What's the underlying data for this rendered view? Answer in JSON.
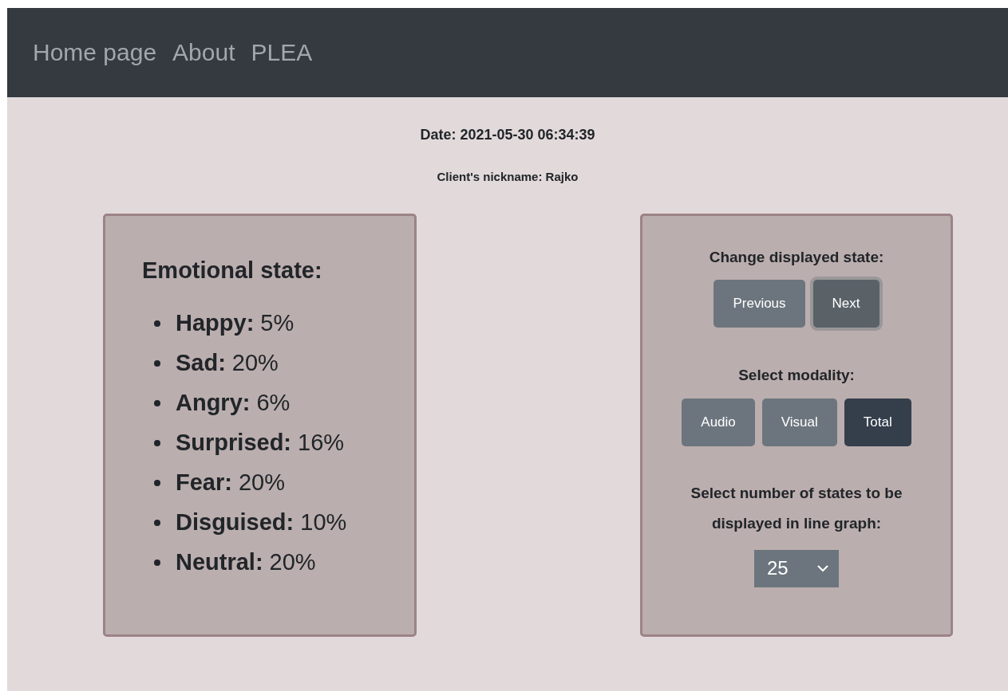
{
  "nav": {
    "links": [
      "Home page",
      "About",
      "PLEA"
    ]
  },
  "header": {
    "date": "Date: 2021-05-30 06:34:39",
    "nickname": "Client's nickname: Rajko"
  },
  "emotions": {
    "title": "Emotional state:",
    "items": [
      {
        "label": "Happy:",
        "value": "5%"
      },
      {
        "label": "Sad:",
        "value": "20%"
      },
      {
        "label": "Angry:",
        "value": "6%"
      },
      {
        "label": "Surprised:",
        "value": "16%"
      },
      {
        "label": "Fear:",
        "value": "20%"
      },
      {
        "label": "Disguised:",
        "value": "10%"
      },
      {
        "label": "Neutral:",
        "value": "20%"
      }
    ]
  },
  "controls": {
    "state_title": "Change displayed state:",
    "state_buttons": [
      {
        "label": "Previous",
        "focused": false
      },
      {
        "label": "Next",
        "focused": true
      }
    ],
    "modality_title": "Select modality:",
    "modality_buttons": [
      {
        "label": "Audio",
        "selected": false
      },
      {
        "label": "Visual",
        "selected": false
      },
      {
        "label": "Total",
        "selected": true
      }
    ],
    "count_title": "Select number of states to be displayed in line graph:",
    "count_select": {
      "value": "25"
    }
  }
}
